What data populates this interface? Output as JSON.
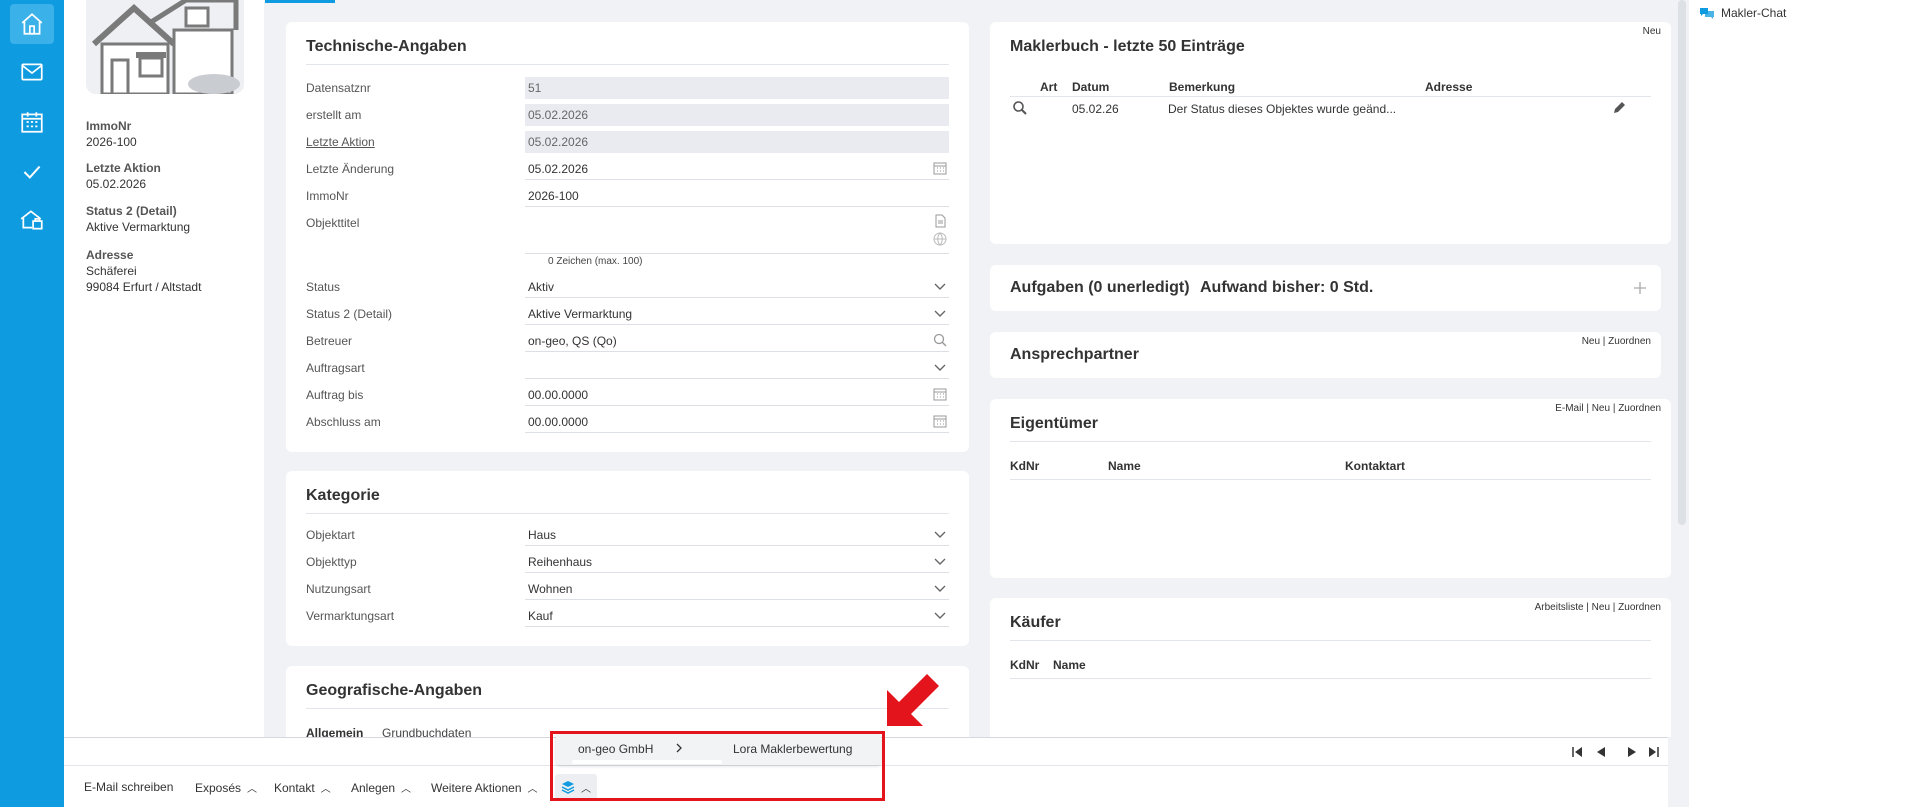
{
  "nav": {
    "items": [
      "home",
      "mail",
      "calendar",
      "tasks",
      "property"
    ]
  },
  "info": {
    "immonr_label": "ImmoNr",
    "immonr": "2026-100",
    "letzte_aktion_label": "Letzte Aktion",
    "letzte_aktion": "05.02.2026",
    "status2_label": "Status 2 (Detail)",
    "status2": "Aktive Vermarktung",
    "adresse_label": "Adresse",
    "adresse1": "Schäferei",
    "adresse2": "99084 Erfurt / Altstadt"
  },
  "technisch": {
    "title": "Technische-Angaben",
    "rows": [
      {
        "label": "Datensatznr",
        "value": "51"
      },
      {
        "label": "erstellt am",
        "value": "05.02.2026"
      },
      {
        "label": "Letzte Aktion",
        "value": "05.02.2026"
      },
      {
        "label": "Letzte Änderung",
        "value": "05.02.2026"
      },
      {
        "label": "ImmoNr",
        "value": "2026-100"
      },
      {
        "label": "Objekttitel",
        "value": ""
      },
      {
        "label": "Status",
        "value": "Aktiv"
      },
      {
        "label": "Status 2 (Detail)",
        "value": "Aktive Vermarktung"
      },
      {
        "label": "Betreuer",
        "value": "on-geo, QS (Qo)"
      },
      {
        "label": "Auftragsart",
        "value": ""
      },
      {
        "label": "Auftrag bis",
        "value": "00.00.0000"
      },
      {
        "label": "Abschluss am",
        "value": "00.00.0000"
      }
    ],
    "char_count": "0 Zeichen (max. 100)"
  },
  "kategorie": {
    "title": "Kategorie",
    "rows": [
      {
        "label": "Objektart",
        "value": "Haus"
      },
      {
        "label": "Objekttyp",
        "value": "Reihenhaus"
      },
      {
        "label": "Nutzungsart",
        "value": "Wohnen"
      },
      {
        "label": "Vermarktungsart",
        "value": "Kauf"
      }
    ]
  },
  "geo": {
    "title": "Geografische-Angaben",
    "tab1": "Allgemein",
    "tab2": "Grundbuchdaten"
  },
  "maklerbuch": {
    "title": "Maklerbuch - letzte 50 Einträge",
    "link_neu": "Neu",
    "headers": [
      "Art",
      "Datum",
      "Bemerkung",
      "Adresse"
    ],
    "row": {
      "datum": "05.02.26",
      "bemerkung": "Der Status dieses Objektes wurde geänd..."
    }
  },
  "aufgaben": {
    "title": "Aufgaben (0 unerledigt)",
    "aufwand": "Aufwand bisher: 0 Std."
  },
  "ansprech": {
    "title": "Ansprechpartner",
    "links": "Neu | Zuordnen"
  },
  "eigentuemer": {
    "title": "Eigentümer",
    "links": "E-Mail | Neu | Zuordnen",
    "headers": [
      "KdNr",
      "Name",
      "Kontaktart"
    ]
  },
  "kaeufer": {
    "title": "Käufer",
    "links": "Arbeitsliste | Neu | Zuordnen",
    "headers": [
      "KdNr",
      "Name"
    ]
  },
  "chat": {
    "label": "Makler-Chat"
  },
  "actions": {
    "email": "E-Mail schreiben",
    "exposes": "Exposés",
    "kontakt": "Kontakt",
    "anlegen": "Anlegen",
    "weitere": "Weitere Aktionen"
  },
  "popup": {
    "item1": "on-geo GmbH",
    "item2": "Lora Maklerbewertung"
  },
  "colors": {
    "accent": "#0f9bdf",
    "highlight": "#e3141b"
  }
}
